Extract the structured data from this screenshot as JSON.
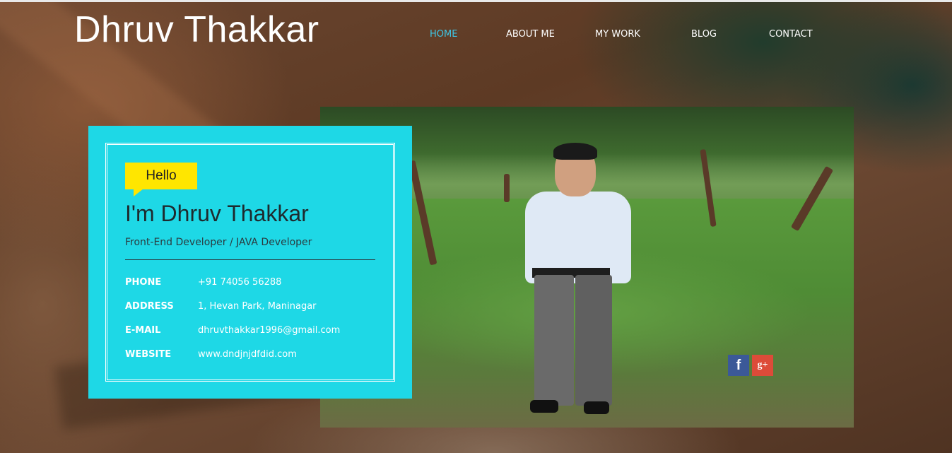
{
  "site": {
    "title": "Dhruv Thakkar"
  },
  "nav": {
    "items": [
      {
        "label": "HOME",
        "active": true
      },
      {
        "label": "ABOUT ME",
        "active": false
      },
      {
        "label": "MY WORK",
        "active": false
      },
      {
        "label": "BLOG",
        "active": false
      },
      {
        "label": "CONTACT",
        "active": false
      }
    ],
    "active_color": "#3ec7e6"
  },
  "card": {
    "greeting": "Hello",
    "name": "I'm Dhruv Thakkar",
    "role": "Front-End Developer / JAVA Developer",
    "background_color": "#1ed8e6",
    "greeting_color": "#ffe600",
    "details": [
      {
        "label": "PHONE",
        "value": "+91 74056 56288"
      },
      {
        "label": "ADDRESS",
        "value": "1, Hevan Park, Maninagar"
      },
      {
        "label": "E-MAIL",
        "value": "dhruvthakkar1996@gmail.com"
      },
      {
        "label": "WEBSITE",
        "value": "www.dndjnjdfdid.com"
      }
    ]
  },
  "social": {
    "facebook": {
      "glyph": "f",
      "color": "#3b5998",
      "icon": "facebook-icon"
    },
    "google_plus": {
      "glyph": "g+",
      "color": "#dd4b39",
      "icon": "google-plus-icon"
    }
  }
}
